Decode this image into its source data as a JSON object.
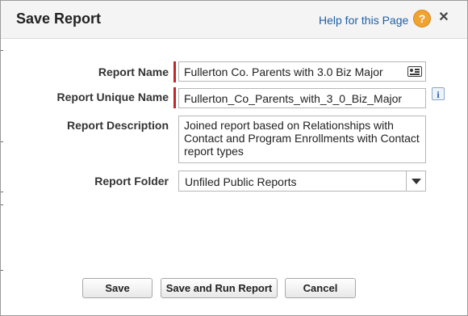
{
  "dialog": {
    "title": "Save Report",
    "help_link": "Help for this Page",
    "help_icon_symbol": "?",
    "close_symbol": "✕"
  },
  "form": {
    "report_name": {
      "label": "Report Name",
      "value": "Fullerton Co. Parents with 3.0 Biz Major",
      "required": true
    },
    "report_unique_name": {
      "label": "Report Unique Name",
      "value": "Fullerton_Co_Parents_with_3_0_Biz_Major",
      "required": true,
      "info_symbol": "i"
    },
    "report_description": {
      "label": "Report Description",
      "value": "Joined report based on Relationships with Contact and Program Enrollments with Contact report types"
    },
    "report_folder": {
      "label": "Report Folder",
      "selected": "Unfiled Public Reports"
    }
  },
  "buttons": {
    "save": "Save",
    "save_and_run": "Save and Run Report",
    "cancel": "Cancel"
  },
  "colors": {
    "required_marker": "#c1272d",
    "help_icon": "#f0a330",
    "link": "#1f5fa6"
  }
}
